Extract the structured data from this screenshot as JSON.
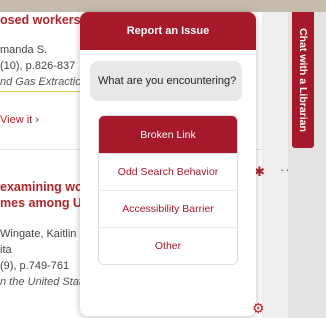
{
  "results": [
    {
      "title": "osed workers w",
      "author": "manda S.",
      "citation": "(10), p.826-837",
      "subject": "nd Gas Extraction (",
      "view": "View it ›"
    },
    {
      "title_line1": "examining worl",
      "title_line2": "mes among U.S",
      "author": "Wingate, Kaitlin C.",
      "author2": "ita",
      "citation": "(9), p.749-761",
      "subject": "n the United States"
    }
  ],
  "librarian_tab": "Chat with a Librarian",
  "popup": {
    "title": "Report an Issue",
    "prompt": "What are you encountering?",
    "options": [
      "Broken Link",
      "Odd Search Behavior",
      "Accessibility Barrier",
      "Other"
    ]
  },
  "icons": {
    "pin": "pin-icon",
    "more": "more-icon",
    "gear": "gear-icon"
  },
  "colors": {
    "accent": "#a5192a",
    "link": "#b0252b"
  }
}
